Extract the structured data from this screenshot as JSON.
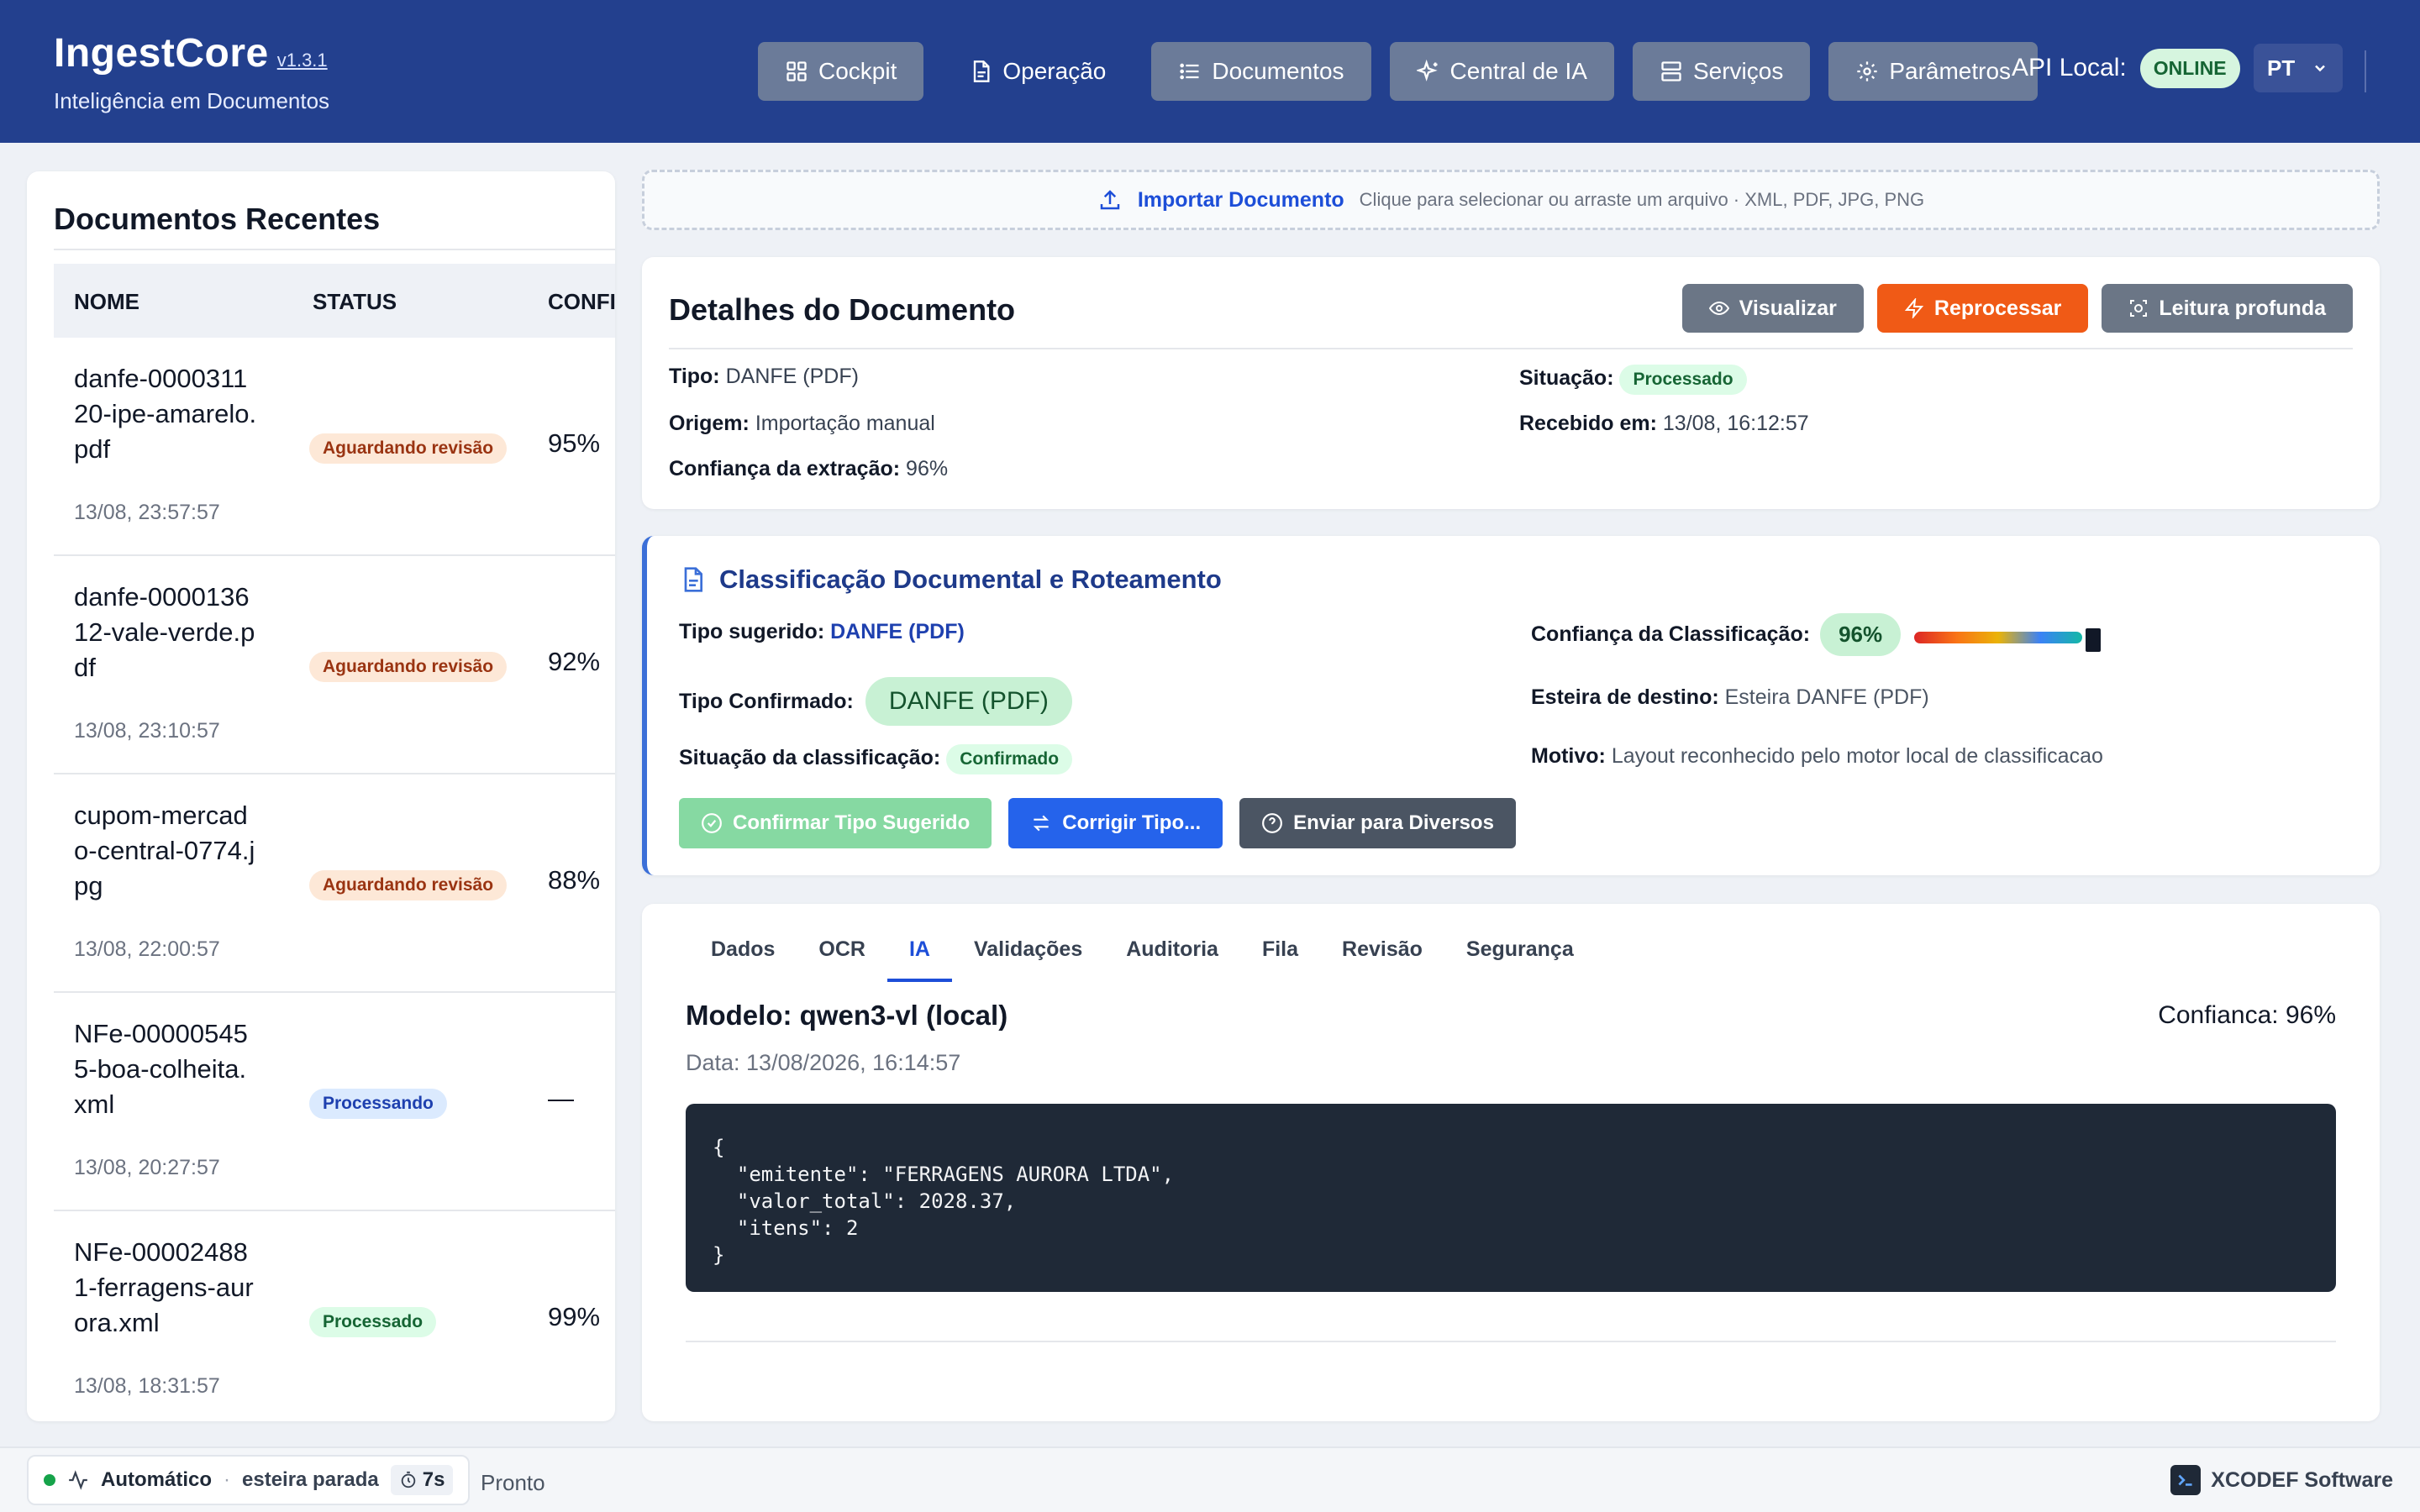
{
  "app": {
    "title": "IngestCore",
    "version": "v1.3.1",
    "subtitle": "Inteligência em Documentos"
  },
  "nav": {
    "items": [
      {
        "label": "Cockpit",
        "icon": "grid-icon"
      },
      {
        "label": "Operação",
        "icon": "document-icon"
      },
      {
        "label": "Documentos",
        "icon": "list-icon"
      },
      {
        "label": "Central de IA",
        "icon": "sparkles-icon"
      },
      {
        "label": "Serviços",
        "icon": "server-icon"
      },
      {
        "label": "Parâmetros",
        "icon": "gear-icon"
      }
    ],
    "api_label": "API Local:",
    "api_status": "ONLINE",
    "language": "PT"
  },
  "sidebar": {
    "title": "Documentos Recentes",
    "columns": [
      "NOME",
      "STATUS",
      "CONFI"
    ],
    "rows": [
      {
        "name": "danfe-000031120-ipe-amarelo.pdf",
        "date": "13/08, 23:57:57",
        "status": "Aguardando revisão",
        "confidence": "95%"
      },
      {
        "name": "danfe-000013612-vale-verde.pdf",
        "date": "13/08, 23:10:57",
        "status": "Aguardando revisão",
        "confidence": "92%"
      },
      {
        "name": "cupom-mercado-central-0774.jpg",
        "date": "13/08, 22:00:57",
        "status": "Aguardando revisão",
        "confidence": "88%"
      },
      {
        "name": "NFe-000005455-boa-colheita.xml",
        "date": "13/08, 20:27:57",
        "status": "Processando",
        "confidence": "—"
      },
      {
        "name": "NFe-000024881-ferragens-aurora.xml",
        "date": "13/08, 18:31:57",
        "status": "Processado",
        "confidence": "99%"
      }
    ]
  },
  "import": {
    "label": "Importar Documento",
    "hint": "Clique para selecionar ou arraste um arquivo · XML, PDF, JPG, PNG"
  },
  "details": {
    "title": "Detalhes do Documento",
    "actions": {
      "view": "Visualizar",
      "reprocess": "Reprocessar",
      "deep_read": "Leitura profunda"
    },
    "type_label": "Tipo:",
    "type_value": "DANFE (PDF)",
    "origin_label": "Origem:",
    "origin_value": "Importação manual",
    "conf_label": "Confiança da extração:",
    "conf_value": "96%",
    "situation_label": "Situação:",
    "situation_value": "Processado",
    "received_label": "Recebido em:",
    "received_value": "13/08, 16:12:57"
  },
  "classification": {
    "title": "Classificação Documental e Roteamento",
    "suggested_label": "Tipo sugerido:",
    "suggested_value": "DANFE (PDF)",
    "confirmed_label": "Tipo Confirmado:",
    "confirmed_value": "DANFE (PDF)",
    "status_label": "Situação da classificação:",
    "status_value": "Confirmado",
    "confidence_label": "Confiança da Classificação:",
    "confidence_value": "96%",
    "confidence_level": 0.96,
    "destination_label": "Esteira de destino:",
    "destination_value": "Esteira DANFE (PDF)",
    "reason_label": "Motivo:",
    "reason_value": "Layout reconhecido pelo motor local de classificacao",
    "buttons": {
      "confirm": "Confirmar Tipo Sugerido",
      "correct": "Corrigir Tipo...",
      "send": "Enviar para Diversos"
    }
  },
  "ia_panel": {
    "tabs": [
      "Dados",
      "OCR",
      "IA",
      "Validações",
      "Auditoria",
      "Fila",
      "Revisão",
      "Segurança"
    ],
    "active_tab": "IA",
    "model": "Modelo: qwen3-vl (local)",
    "confidence": "Confianca: 96%",
    "date": "Data: 13/08/2026, 16:14:57",
    "json_output": "{\n  \"emitente\": \"FERRAGENS AURORA LTDA\",\n  \"valor_total\": 2028.37,\n  \"itens\": 2\n}"
  },
  "footer": {
    "mode": "Automático",
    "separator": "·",
    "pipeline": "esteira parada",
    "timer": "7s",
    "status": "Pronto",
    "brand": "XCODEF Software"
  },
  "colors": {
    "header_bg": "#23408e",
    "accent_blue": "#2563eb",
    "accent_orange": "#f05a16",
    "success_green": "#16a34a"
  }
}
